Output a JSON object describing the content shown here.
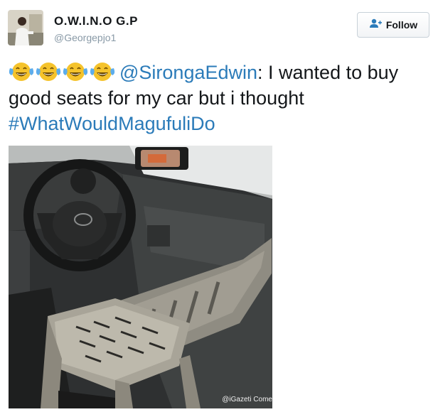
{
  "user": {
    "display_name": "O.W.I.N.O G.P",
    "handle": "@Georgepjo1"
  },
  "follow_button": {
    "label": "Follow",
    "icon": "add-user-icon"
  },
  "tweet": {
    "emoji": [
      "face-with-tears-of-joy",
      "face-with-tears-of-joy",
      "face-with-tears-of-joy",
      "face-with-tears-of-joy"
    ],
    "mention": "@SirongaEdwin",
    "text": ": I wanted to buy good seats for my car but i thought",
    "hashtag": "#WhatWouldMagufuliDo"
  },
  "photo": {
    "watermark": "@iGazeti Come"
  },
  "colors": {
    "link": "#2b7bb9",
    "text": "#14171a",
    "muted": "#8899a6"
  }
}
